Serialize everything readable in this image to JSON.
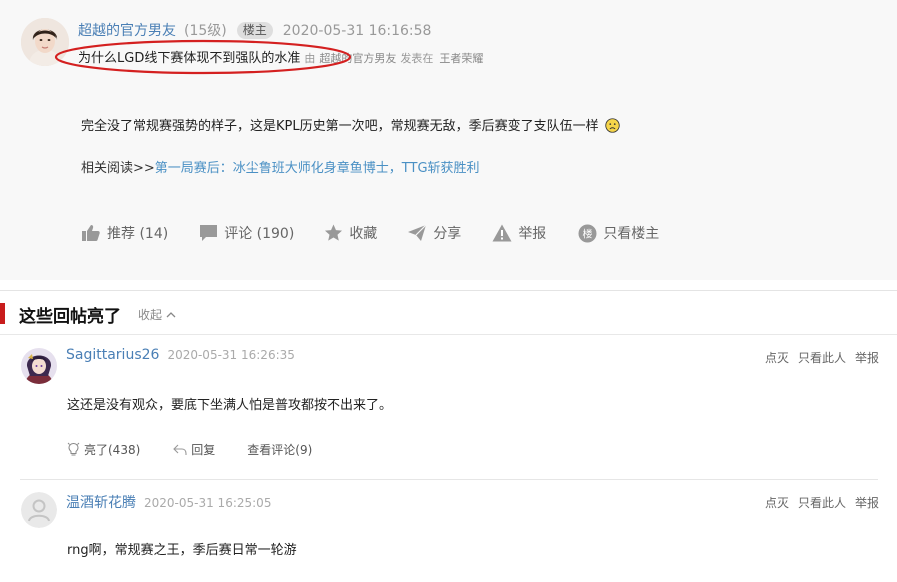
{
  "post": {
    "author": "超越的官方男友",
    "level": "(15级)",
    "owner_badge": "楼主",
    "time": "2020-05-31 16:16:58",
    "title": "为什么LGD线下赛体现不到强队的水准",
    "by_text": "由",
    "by_author": "超越的官方男友",
    "in_text": "发表在",
    "board": "王者荣耀",
    "body": "完全没了常规赛强势的样子，这是KPL历史第一次吧，常规赛无敌，季后赛变了支队伍一样",
    "related_label": "相关阅读>>",
    "related_link": "第一局赛后：冰尘鲁班大师化身章鱼博士，TTG斩获胜利",
    "actions": {
      "recommend": "推荐 (14)",
      "comment": "评论 (190)",
      "favorite": "收藏",
      "share": "分享",
      "report": "举报",
      "owner_only": "只看楼主"
    },
    "owner_only_icon_text": "楼"
  },
  "hot_replies": {
    "title": "这些回帖亮了",
    "collapse_label": "收起",
    "items": [
      {
        "user": "Sagittarius26",
        "time": "2020-05-31 16:26:35",
        "ops": [
          "点灭",
          "只看此人",
          "举报"
        ],
        "content": "这还是没有观众，要底下坐满人怕是普攻都按不出来了。",
        "light": "亮了(438)",
        "reply": "回复",
        "view_comments": "查看评论(9)"
      },
      {
        "user": "温酒斩花腾",
        "time": "2020-05-31 16:25:05",
        "ops": [
          "点灭",
          "只看此人",
          "举报"
        ],
        "content": "rng啊，常规赛之王，季后赛日常一轮游"
      }
    ]
  },
  "colors": {
    "link_blue": "#4a7fb5",
    "related_link": "#4a90c4",
    "accent_red": "#c81c1c",
    "annotation_red": "#d42020"
  }
}
